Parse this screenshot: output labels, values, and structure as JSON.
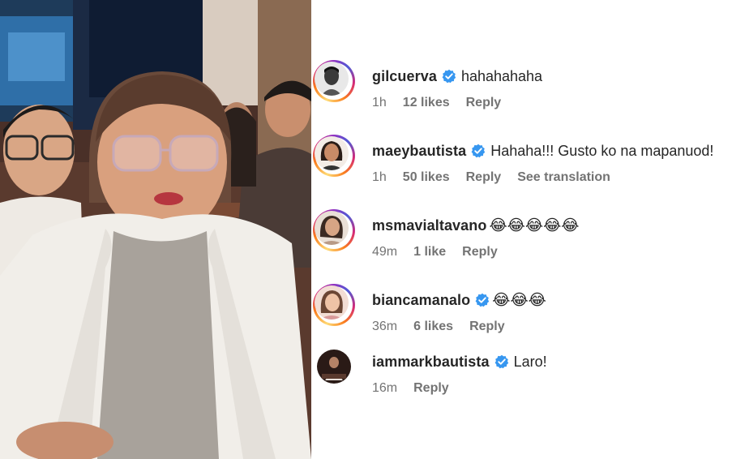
{
  "comments": [
    {
      "username": "gilcuerva",
      "verified": true,
      "text": "hahahahaha",
      "emojis": "",
      "time": "1h",
      "likes": "12 likes",
      "reply": "Reply",
      "see_translation": ""
    },
    {
      "username": "maeybautista",
      "verified": true,
      "text": "Hahaha!!! Gusto ko na mapanuod!",
      "emojis": "",
      "time": "1h",
      "likes": "50 likes",
      "reply": "Reply",
      "see_translation": "See translation"
    },
    {
      "username": "msmavialtavano",
      "verified": false,
      "text": "",
      "emojis": "😂😂😂😂😂",
      "time": "49m",
      "likes": "1 like",
      "reply": "Reply",
      "see_translation": ""
    },
    {
      "username": "biancamanalo",
      "verified": true,
      "text": "",
      "emojis": "😂😂😂",
      "time": "36m",
      "likes": "6 likes",
      "reply": "Reply",
      "see_translation": ""
    },
    {
      "username": "iammarkbautista",
      "verified": true,
      "text": "Laro!",
      "emojis": "",
      "time": "16m",
      "likes": "",
      "reply": "Reply",
      "see_translation": ""
    }
  ],
  "colors": {
    "verified_blue": "#3797f0",
    "secondary_text": "#737373",
    "primary_text": "#262626"
  }
}
